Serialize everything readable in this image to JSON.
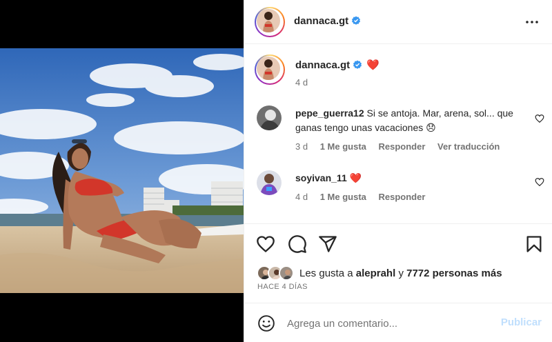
{
  "post": {
    "author": "dannaca.gt",
    "caption_emoji": "❤️",
    "caption_time": "4 d"
  },
  "comments": [
    {
      "user": "pepe_guerra12",
      "text": "Si se antoja. Mar, arena, sol... que ganas tengo unas vacaciones 😞",
      "time": "3 d",
      "likes": "1 Me gusta",
      "reply": "Responder",
      "translate": "Ver traducción"
    },
    {
      "user": "soyivan_11",
      "text": "❤️",
      "time": "4 d",
      "likes": "1 Me gusta",
      "reply": "Responder"
    }
  ],
  "likes": {
    "prefix": "Les gusta a",
    "user": "aleprahl",
    "connector": "y",
    "others": "7772 personas más"
  },
  "timestamp": "HACE 4 DÍAS",
  "composer": {
    "placeholder": "Agrega un comentario...",
    "publish_label": "Publicar"
  },
  "colors": {
    "verified": "#3897f0",
    "heart": "#ed4956",
    "publish_disabled": "#c0dffd",
    "secondary_text": "#737373"
  },
  "icons": [
    "more-options-icon",
    "verified-badge-icon",
    "heart-icon",
    "comment-icon",
    "share-icon",
    "save-icon",
    "emoji-icon"
  ]
}
